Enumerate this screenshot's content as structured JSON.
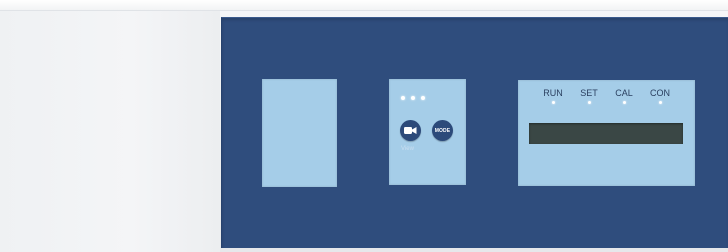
{
  "control_panel": {
    "button_module": {
      "indicator_count": 3,
      "camera_button_icon": "camera-icon",
      "mode_button_label": "MODE",
      "caption": "View"
    },
    "display_module": {
      "status_indicators": [
        {
          "label": "RUN"
        },
        {
          "label": "SET"
        },
        {
          "label": "CAL"
        },
        {
          "label": "CON"
        }
      ],
      "lcd_text": ""
    }
  },
  "colors": {
    "panel_background": "#2f4d7d",
    "module_background": "#a5cde8",
    "lcd_background": "#3a4745",
    "housing": "#eef0f2"
  }
}
